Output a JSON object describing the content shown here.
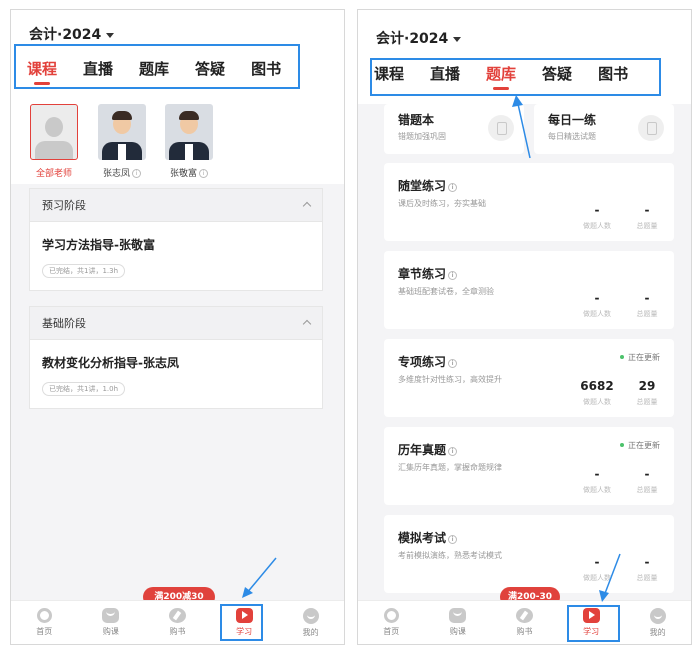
{
  "left": {
    "course_selector": "会计·2024",
    "tabs": [
      "课程",
      "直播",
      "题库",
      "答疑",
      "图书"
    ],
    "active_tab": "课程",
    "teachers": [
      {
        "name": "全部老师",
        "selected": true
      },
      {
        "name": "张志凤",
        "info_icon": true
      },
      {
        "name": "张敬富",
        "info_icon": true
      }
    ],
    "stages": [
      {
        "header": "预习阶段",
        "item_title": "学习方法指导-张敬富",
        "item_meta": "已完结，共1讲，1.3h"
      },
      {
        "header": "基础阶段",
        "item_title": "教材变化分析指导-张志凤",
        "item_meta": "已完结，共1讲，1.0h"
      }
    ],
    "promo": "满200减30"
  },
  "right": {
    "course_selector": "会计·2024",
    "tabs": [
      "课程",
      "直播",
      "题库",
      "答疑",
      "图书"
    ],
    "active_tab": "题库",
    "top_cards": [
      {
        "title": "错题本",
        "sub": "错题加强巩固"
      },
      {
        "title": "每日一练",
        "sub": "每日精选试题"
      }
    ],
    "practice_cards": [
      {
        "title": "随堂练习",
        "desc": "课后及时练习，夯实基础",
        "status": "",
        "users": "-",
        "total": "-"
      },
      {
        "title": "章节练习",
        "desc": "基础班配套试卷，全章测验",
        "status": "",
        "users": "-",
        "total": "-"
      },
      {
        "title": "专项练习",
        "desc": "多维度针对性练习，高效提升",
        "status": "正在更新",
        "users": "6682",
        "total": "29"
      },
      {
        "title": "历年真题",
        "desc": "汇集历年真题，掌握命题规律",
        "status": "正在更新",
        "users": "-",
        "total": "-"
      },
      {
        "title": "模拟考试",
        "desc": "考前模拟演练，熟悉考试模式",
        "status": "",
        "users": "-",
        "total": "-"
      }
    ],
    "stat_labels": {
      "users": "做题人数",
      "total": "总题量"
    },
    "promo": "满200-30"
  },
  "bottom_nav": [
    {
      "label": "首页",
      "icon": "home-icon"
    },
    {
      "label": "购课",
      "icon": "cart-icon"
    },
    {
      "label": "购书",
      "icon": "book-icon"
    },
    {
      "label": "学习",
      "icon": "learn-icon",
      "active": true
    },
    {
      "label": "我的",
      "icon": "profile-icon"
    }
  ],
  "colors": {
    "accent": "#e2413b",
    "highlight": "#2d8be6",
    "status_green": "#4cc26b"
  }
}
